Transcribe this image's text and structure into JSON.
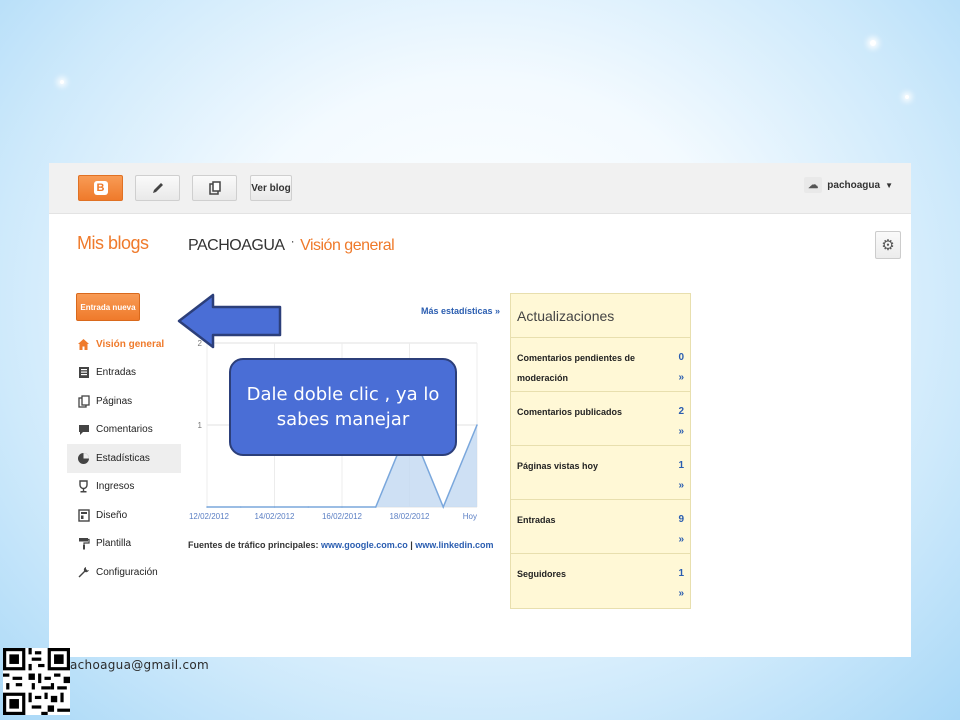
{
  "topbar": {
    "view_blog_label": "Ver blog",
    "username": "pachoagua",
    "icons": [
      "blogger-icon",
      "pencil-icon",
      "pages-icon",
      "avatar-icon",
      "caret-down-icon"
    ]
  },
  "header": {
    "my_blogs": "Mis blogs",
    "blog_name": "PACHOAGUA",
    "separator": "·",
    "current_page": "Visión general"
  },
  "sidebar": {
    "new_post_label": "Entrada nueva",
    "items": [
      {
        "label": "Visión general",
        "icon": "home-icon",
        "active": true
      },
      {
        "label": "Entradas",
        "icon": "posts-icon"
      },
      {
        "label": "Páginas",
        "icon": "pages-icon"
      },
      {
        "label": "Comentarios",
        "icon": "comments-icon"
      },
      {
        "label": "Estadísticas",
        "icon": "stats-pie-icon",
        "selected": true
      },
      {
        "label": "Ingresos",
        "icon": "trophy-icon"
      },
      {
        "label": "Diseño",
        "icon": "layout-icon"
      },
      {
        "label": "Plantilla",
        "icon": "paint-roller-icon"
      },
      {
        "label": "Configuración",
        "icon": "wrench-icon"
      }
    ]
  },
  "stats": {
    "more_stats": "Más estadísticas »",
    "traffic_label": "Fuentes de tráfico principales:",
    "traffic_source_1": "www.google.com.co",
    "traffic_sep": "|",
    "traffic_source_2": "www.linkedin.com"
  },
  "chart_data": {
    "type": "area",
    "y_ticks": [
      "1",
      "2"
    ],
    "x_tick_labels": [
      "12/02/2012",
      "14/02/2012",
      "16/02/2012",
      "18/02/2012",
      "Hoy"
    ],
    "ylim": [
      0,
      2
    ],
    "x": [
      0,
      1,
      2,
      3,
      4,
      5,
      6,
      7,
      8
    ],
    "values": [
      0,
      0,
      0,
      0,
      0,
      0,
      1,
      0,
      1
    ],
    "fill_color": "#c6daf2",
    "line_color": "#7aa7dc"
  },
  "updates": {
    "title": "Actualizaciones",
    "rows": [
      {
        "label": "Comentarios pendientes de moderación",
        "count": "0",
        "more": "»"
      },
      {
        "label": "Comentarios publicados",
        "count": "2",
        "more": "»"
      },
      {
        "label": "Páginas vistas hoy",
        "count": "1",
        "more": "»"
      },
      {
        "label": "Entradas",
        "count": "9",
        "more": "»"
      },
      {
        "label": "Seguidores",
        "count": "1",
        "more": "»"
      }
    ]
  },
  "callout": {
    "text": "Dale doble  clic , ya lo sabes manejar"
  },
  "footer": {
    "email": "achoagua@gmail.com"
  },
  "colors": {
    "accent": "#ef7a2b",
    "link": "#2a5db0",
    "callout": "#4a6ed6",
    "updates_bg": "#fff8d6"
  }
}
